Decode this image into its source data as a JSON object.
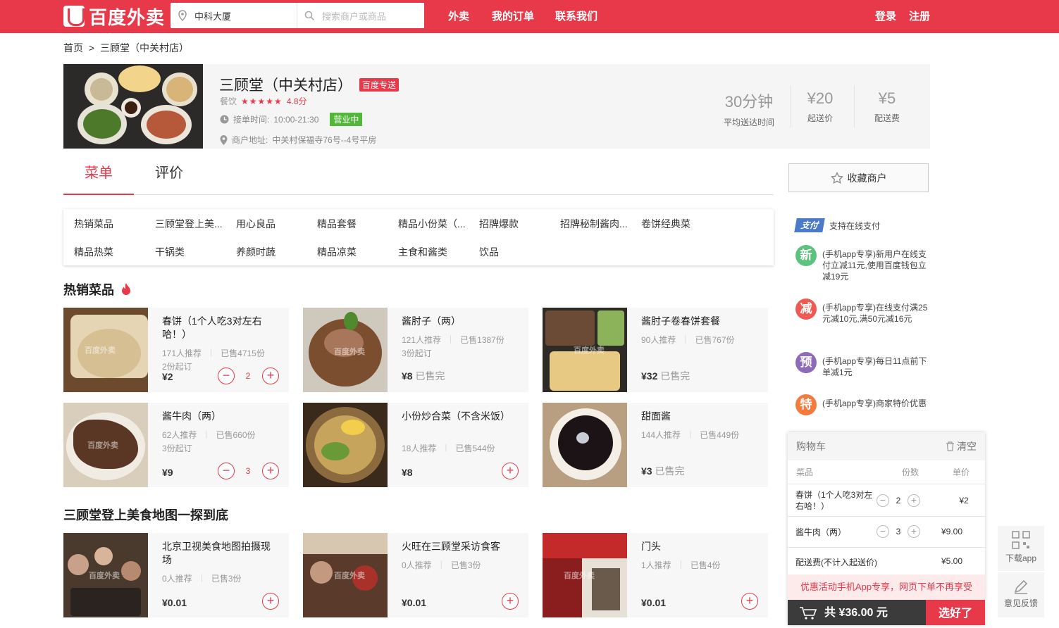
{
  "header": {
    "logo_text": "百度外卖",
    "address_value": "中科大厦",
    "search_placeholder": "搜索商户或商品",
    "nav": [
      "外卖",
      "我的订单",
      "联系我们"
    ],
    "login": "登录",
    "register": "注册",
    "brand_color": "#e8394a"
  },
  "breadcrumb": {
    "home": "首页",
    "sep": ">",
    "current": "三顾堂（中关村店）"
  },
  "shop": {
    "name": "三顾堂（中关村店）",
    "delivery_tag": "百度专送",
    "category": "餐饮",
    "stars": "★★★★★",
    "rating": "4.8分",
    "hours_label": "接单时间:",
    "hours": "10:00-21:30",
    "status": "营业中",
    "address_label": "商户地址:",
    "address": "中关村保福寺76号--4号平房",
    "stats": [
      {
        "value": "30分钟",
        "label": "平均送达时间"
      },
      {
        "value": "¥20",
        "label": "起送价"
      },
      {
        "value": "¥5",
        "label": "配送费"
      }
    ]
  },
  "tabs": [
    "菜单",
    "评价"
  ],
  "categories": [
    "热销菜品",
    "三顾堂登上美...",
    "用心良品",
    "精品套餐",
    "精品小份菜（...",
    "招牌爆款",
    "招牌秘制酱肉...",
    "卷饼经典菜",
    "精品热菜",
    "干锅类",
    "养颜时蔬",
    "精品凉菜",
    "主食和酱类",
    "饮品"
  ],
  "sections": [
    {
      "title": "热销菜品",
      "items": [
        {
          "name": "春饼（1个人吃3对左右哈！）",
          "recommend": "171人推荐",
          "sold": "已售4715份",
          "min": "2份起订",
          "price": "¥2",
          "soldout": "",
          "qty": "2"
        },
        {
          "name": "酱肘子（两）",
          "recommend": "121人推荐",
          "sold": "已售1387份",
          "min": "3份起订",
          "price": "¥8",
          "soldout": "已售完",
          "qty": ""
        },
        {
          "name": "酱肘子卷春饼套餐",
          "recommend": "90人推荐",
          "sold": "已售767份",
          "min": "",
          "price": "¥32",
          "soldout": "已售完",
          "qty": ""
        },
        {
          "name": "酱牛肉（两）",
          "recommend": "62人推荐",
          "sold": "已售660份",
          "min": "3份起订",
          "price": "¥9",
          "soldout": "",
          "qty": "3"
        },
        {
          "name": "小份炒合菜（不含米饭）",
          "recommend": "18人推荐",
          "sold": "已售544份",
          "min": "",
          "price": "¥8",
          "soldout": "",
          "qty": ""
        },
        {
          "name": "甜面酱",
          "recommend": "144人推荐",
          "sold": "已售449份",
          "min": "",
          "price": "¥3",
          "soldout": "已售完",
          "qty": ""
        }
      ]
    },
    {
      "title": "三顾堂登上美食地图一探到底",
      "items": [
        {
          "name": "北京卫视美食地图拍摄现场",
          "recommend": "0人推荐",
          "sold": "已售3份",
          "price": "¥0.01"
        },
        {
          "name": "火旺在三顾堂采访食客",
          "recommend": "0人推荐",
          "sold": "已售3份",
          "price": "¥0.01"
        },
        {
          "name": "门头",
          "recommend": "1人推荐",
          "sold": "已售4份",
          "price": "¥0.01"
        }
      ]
    }
  ],
  "watermark": "百度外卖",
  "sidebar": {
    "favorite": "收藏商户",
    "pay_icon": "支付",
    "pay_text": "支持在线支付",
    "promos": [
      {
        "badge": "新",
        "color": "#5bc37e",
        "text": "(手机app专享)新用户在线支付立减11元,使用百度钱包立减19元"
      },
      {
        "badge": "减",
        "color": "#ef5b52",
        "text": "(手机app专享)在线支付满25元减10元,满50元减16元"
      },
      {
        "badge": "预",
        "color": "#8e6bb8",
        "text": "(手机app专享)每日11点前下单减1元"
      },
      {
        "badge": "特",
        "color": "#f47a3d",
        "text": "(手机app专享)商家特价优惠"
      }
    ]
  },
  "cart": {
    "title": "购物车",
    "clear": "清空",
    "cols": [
      "菜品",
      "份数",
      "单价"
    ],
    "rows": [
      {
        "name": "春饼（1个人吃3对左右哈！）",
        "qty": "2",
        "price": "¥2"
      },
      {
        "name": "酱牛肉（两）",
        "qty": "3",
        "price": "¥9.00"
      }
    ],
    "delivery_label": "配送费(不计入起送价)",
    "delivery_price": "¥5.00",
    "note": "优惠活动手机App专享，网页下单不再享受",
    "total": "共 ¥36.00 元",
    "checkout": "选好了"
  },
  "float_buttons": [
    "下载app",
    "意见反馈"
  ]
}
